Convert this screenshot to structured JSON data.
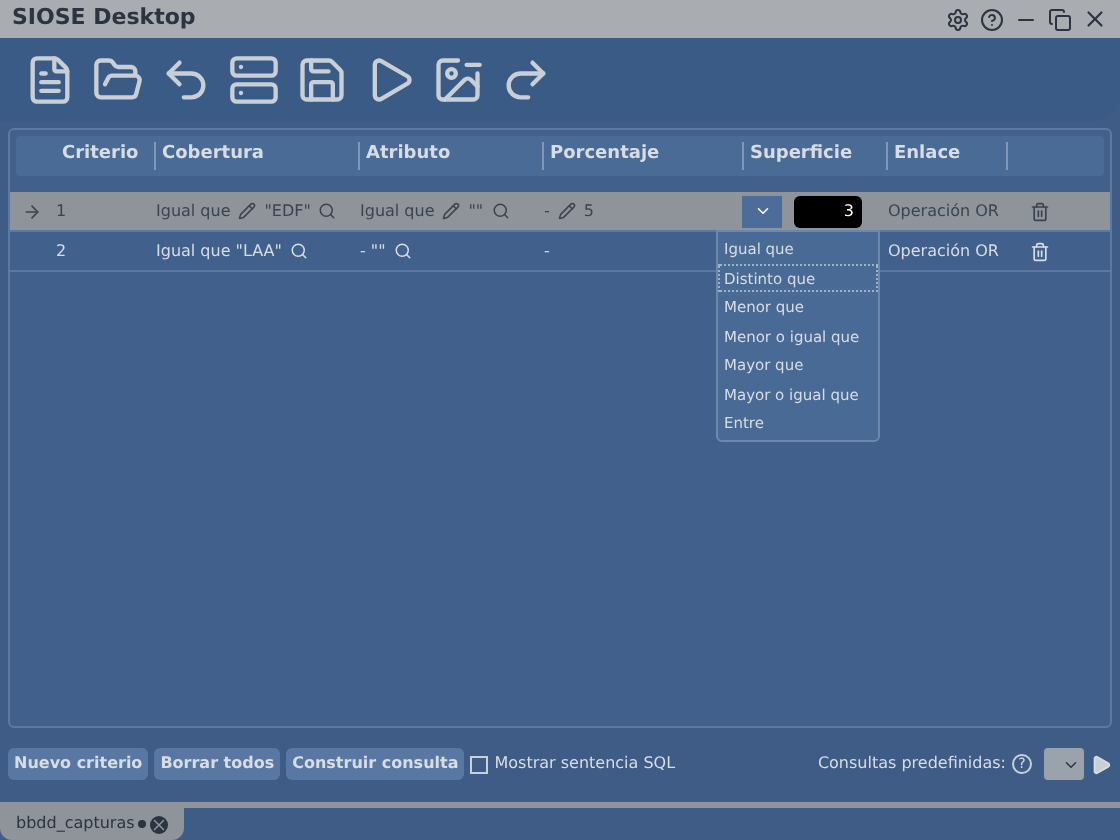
{
  "window": {
    "title": "SIOSE Desktop"
  },
  "table": {
    "columns": [
      "Criterio",
      "Cobertura",
      "Atributo",
      "Porcentaje",
      "Superficie",
      "Enlace"
    ],
    "rows": [
      {
        "selected": true,
        "criterio": "1",
        "cobertura_op": "Igual que",
        "cobertura_value": "\"EDF\"",
        "atributo_op": "Igual que",
        "atributo_value": "\"\"",
        "porcentaje_op": "-",
        "porcentaje_value": "5",
        "superficie_value": "3",
        "enlace": "Operación OR"
      },
      {
        "selected": false,
        "criterio": "2",
        "cobertura_op": "Igual que \"LAA\"",
        "atributo_op": "- \"\"",
        "porcentaje_op": "-",
        "enlace": "Operación OR"
      }
    ]
  },
  "dropdown": {
    "options": [
      {
        "label": "Igual que",
        "selected": false
      },
      {
        "label": "Distinto que",
        "selected": true
      },
      {
        "label": "Menor que",
        "selected": false
      },
      {
        "label": "Menor o igual que",
        "selected": false
      },
      {
        "label": "Mayor que",
        "selected": false
      },
      {
        "label": "Mayor o igual que",
        "selected": false
      },
      {
        "label": "Entre",
        "selected": false
      }
    ]
  },
  "buttons": [
    "Nuevo criterio",
    "Borrar todos",
    "Construir consulta"
  ],
  "show_sql": {
    "label": "Mostrar sentencia SQL",
    "checked": false
  },
  "predefined": {
    "label": "Consultas predefinidas:",
    "help": "?"
  },
  "tabs": [
    {
      "label": "bbdd_capturas",
      "selected": true,
      "modified": true
    }
  ]
}
